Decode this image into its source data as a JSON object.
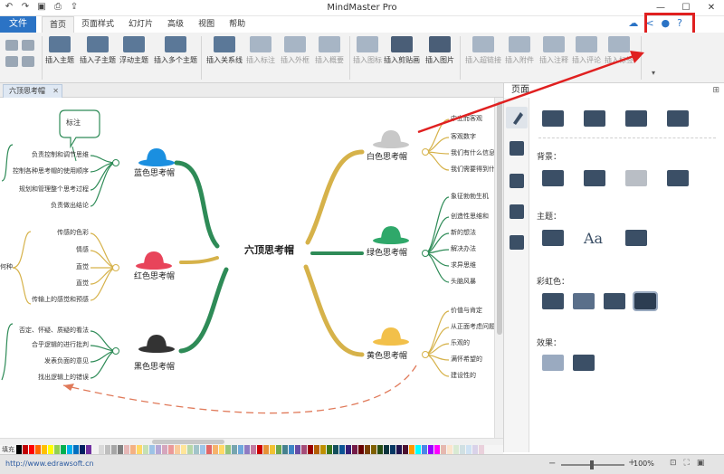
{
  "app": {
    "title": "MindMaster Pro",
    "quick_access": [
      "undo-icon",
      "redo-icon",
      "save-icon",
      "print-icon",
      "export-icon"
    ],
    "window_controls": [
      "minimize",
      "maximize",
      "close"
    ]
  },
  "menu": {
    "file_label": "文件",
    "tabs": [
      {
        "label": "首页",
        "active": true
      },
      {
        "label": "页面样式",
        "active": false
      },
      {
        "label": "幻灯片",
        "active": false
      },
      {
        "label": "高级",
        "active": false
      },
      {
        "label": "视图",
        "active": false
      },
      {
        "label": "帮助",
        "active": false
      }
    ],
    "share_label": "分享"
  },
  "ribbon": {
    "groups": [
      {
        "label": "插入主题",
        "enabled": true
      },
      {
        "label": "插入子主题",
        "enabled": true
      },
      {
        "label": "浮动主题",
        "enabled": true
      },
      {
        "label": "插入多个主题",
        "enabled": true
      },
      {
        "label": "插入关系线",
        "enabled": true
      },
      {
        "label": "插入标注",
        "enabled": false
      },
      {
        "label": "插入外框",
        "enabled": false
      },
      {
        "label": "插入概要",
        "enabled": false
      },
      {
        "label": "插入图标",
        "enabled": false
      },
      {
        "label": "插入剪贴画",
        "enabled": true
      },
      {
        "label": "插入图片",
        "enabled": true
      },
      {
        "label": "插入超链接",
        "enabled": false
      },
      {
        "label": "插入附件",
        "enabled": false
      },
      {
        "label": "插入注释",
        "enabled": false
      },
      {
        "label": "插入评论",
        "enabled": false
      },
      {
        "label": "插入标签",
        "enabled": false
      }
    ]
  },
  "document": {
    "tab_title": "六顶思考帽"
  },
  "mindmap": {
    "center": "六顶思考帽",
    "callout": "标注",
    "hats": [
      {
        "label": "蓝色思考帽",
        "color": "#1a8fe0",
        "branch": "#2e8b57",
        "items": [
          "负责控制和调节思维",
          "控制各种思考帽的使用顺序",
          "规划和管理整个思考过程",
          "负责做出结论"
        ]
      },
      {
        "label": "红色思考帽",
        "color": "#e8445a",
        "branch": "#d6b24a",
        "items": [
          "传感的色彩",
          "情感",
          "直觉",
          "直觉",
          "传输上的感觉和预感"
        ]
      },
      {
        "label": "黑色思考帽",
        "color": "#333333",
        "branch": "#2e8b57",
        "items": [
          "否定、怀疑、质疑的看法",
          "合乎逻辑的进行批判",
          "发表负面的意见",
          "找出逻辑上的错误"
        ]
      },
      {
        "label": "白色思考帽",
        "color": "#c8c8c8",
        "branch": "#d6b24a",
        "items": [
          "中立而客观",
          "客观数字",
          "我们有什么信息",
          "我们需要得到什么"
        ]
      },
      {
        "label": "绿色思考帽",
        "color": "#2fa86a",
        "branch": "#2e8b57",
        "items": [
          "象征勃勃生机",
          "创造性思维和",
          "新的想法",
          "解决办法",
          "求异思维",
          "头脑风暴"
        ]
      },
      {
        "label": "黄色思考帽",
        "color": "#f2c04a",
        "branch": "#d6b24a",
        "items": [
          "价值与肯定",
          "从正面考虑问题",
          "乐观的",
          "满怀希望的",
          "建设性的"
        ]
      }
    ],
    "partial_left_labels": [
      "何种"
    ]
  },
  "panel": {
    "title": "页面",
    "sections": {
      "background": "背景：",
      "theme": "主题：",
      "rainbow": "彩虹色：",
      "effect": "效果："
    }
  },
  "palette": {
    "label": "填充"
  },
  "status": {
    "url": "http://www.edrawsoft.cn",
    "zoom": "100%"
  },
  "colors": {
    "accent": "#2b73c5",
    "highlight": "#e02020",
    "arrow": "#e02020",
    "blue_branch": "#2e8b57",
    "yellow_branch": "#d6b24a",
    "dashed_relation": "#e07a5a"
  }
}
